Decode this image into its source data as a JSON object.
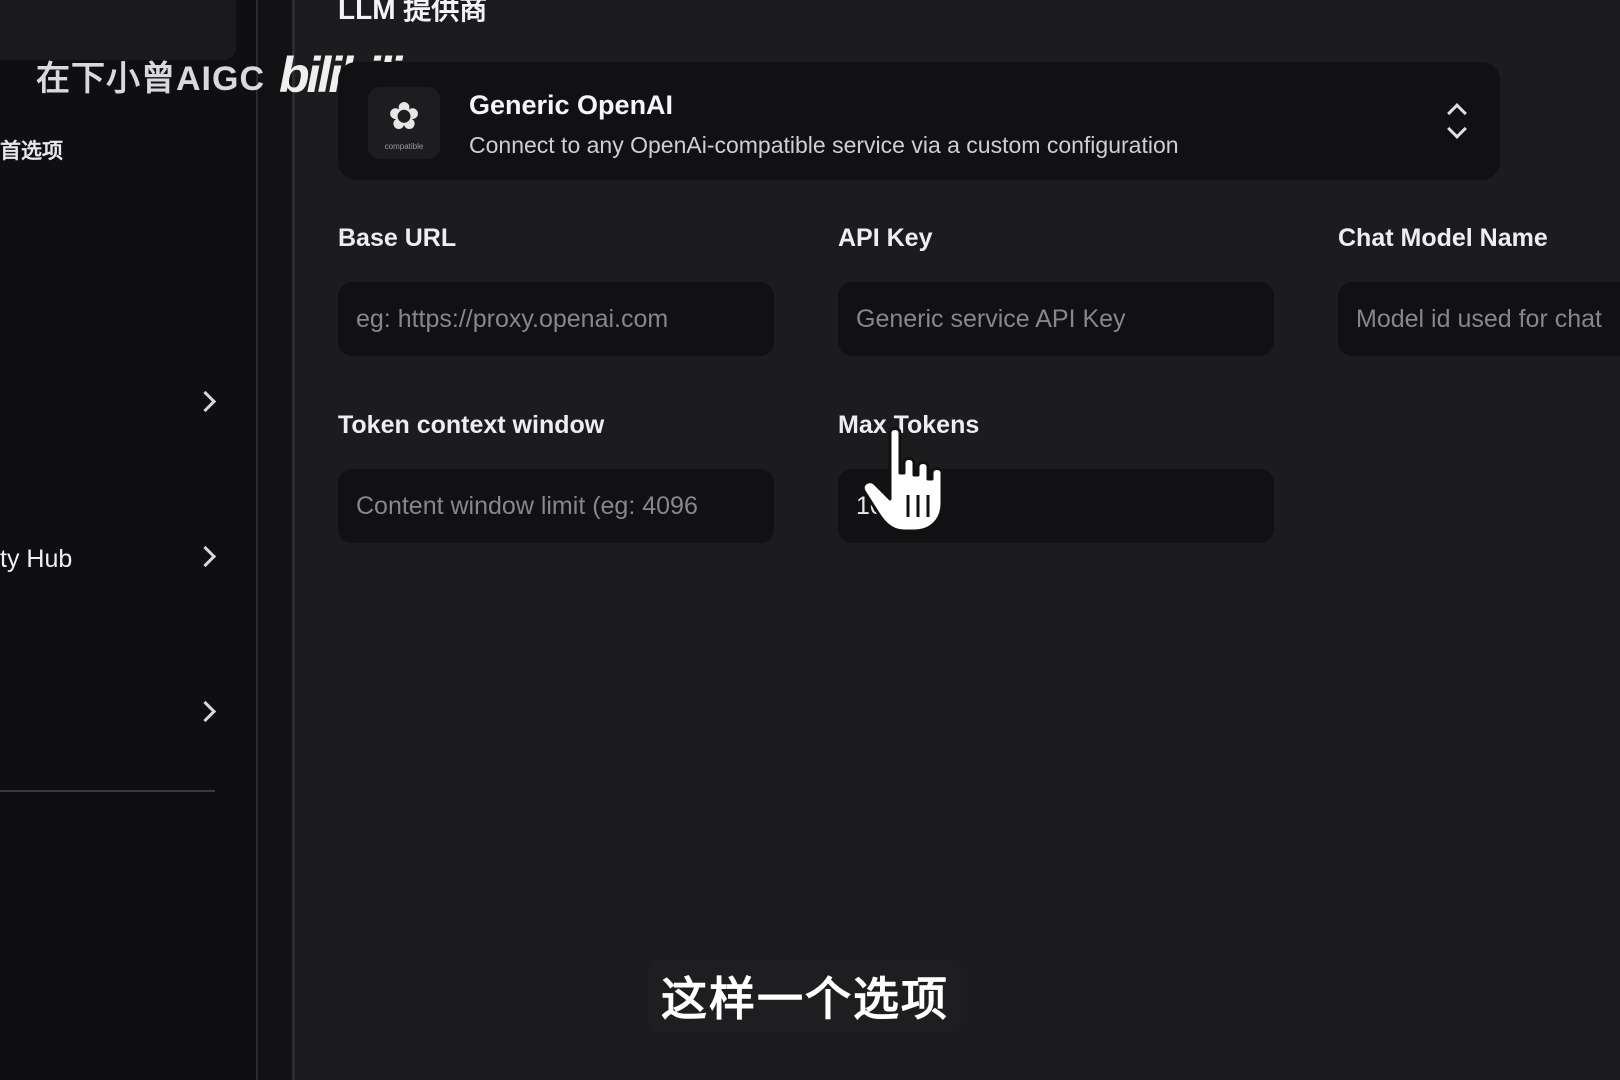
{
  "watermark": {
    "author": "在下小曾AIGC",
    "logo": "bilibili"
  },
  "sidebar": {
    "section_title": "首选项",
    "items": [
      {
        "label": ""
      },
      {
        "label": "ty Hub"
      },
      {
        "label": ""
      }
    ]
  },
  "main": {
    "heading": "LLM 提供商",
    "provider": {
      "name": "Generic OpenAI",
      "description": "Connect to any OpenAi-compatible service via a custom configuration",
      "icon_caption": "compatible",
      "icon": "openai-logo-icon"
    },
    "fields": {
      "base_url": {
        "label": "Base URL",
        "placeholder": "eg: https://proxy.openai.com",
        "value": ""
      },
      "api_key": {
        "label": "API Key",
        "placeholder": "Generic service API Key",
        "value": ""
      },
      "chat_model": {
        "label": "Chat Model Name",
        "placeholder": "Model id used for chat",
        "value": ""
      },
      "token_window": {
        "label": "Token context window",
        "placeholder": "Content window limit (eg: 4096",
        "value": ""
      },
      "max_tokens": {
        "label": "Max Tokens",
        "placeholder": "",
        "value": "10"
      }
    }
  },
  "subtitle": "这样一个选项",
  "colors": {
    "background": "#1c1c1f",
    "panel": "#111113",
    "sidebar": "#0f0f11"
  }
}
